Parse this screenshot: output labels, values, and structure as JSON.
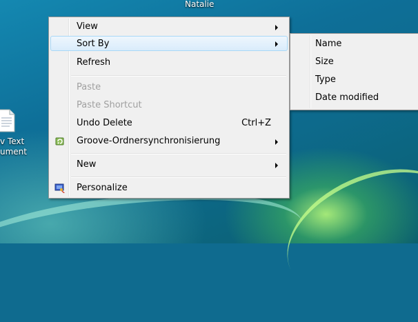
{
  "desktop": {
    "top_label": "Natalie",
    "icon_label_lines": [
      "v Text",
      "ument"
    ]
  },
  "context_menu": {
    "items": [
      {
        "label": "View",
        "submenu": true
      },
      {
        "label": "Sort By",
        "submenu": true,
        "highlighted": true
      },
      {
        "label": "Refresh"
      },
      {
        "label": "Paste",
        "disabled": true
      },
      {
        "label": "Paste Shortcut",
        "disabled": true
      },
      {
        "label": "Undo Delete",
        "shortcut": "Ctrl+Z"
      },
      {
        "label": "Groove-Ordnersynchronisierung",
        "submenu": true,
        "icon": "groove-sync-icon"
      },
      {
        "label": "New",
        "submenu": true
      },
      {
        "label": "Personalize",
        "icon": "personalize-icon"
      }
    ]
  },
  "sort_by_submenu": {
    "items": [
      {
        "label": "Name"
      },
      {
        "label": "Size"
      },
      {
        "label": "Type"
      },
      {
        "label": "Date modified"
      }
    ]
  },
  "colors": {
    "menu_background": "#f0f0f0",
    "highlight_border": "#a8d8f7",
    "disabled_text": "#a0a0a0"
  }
}
